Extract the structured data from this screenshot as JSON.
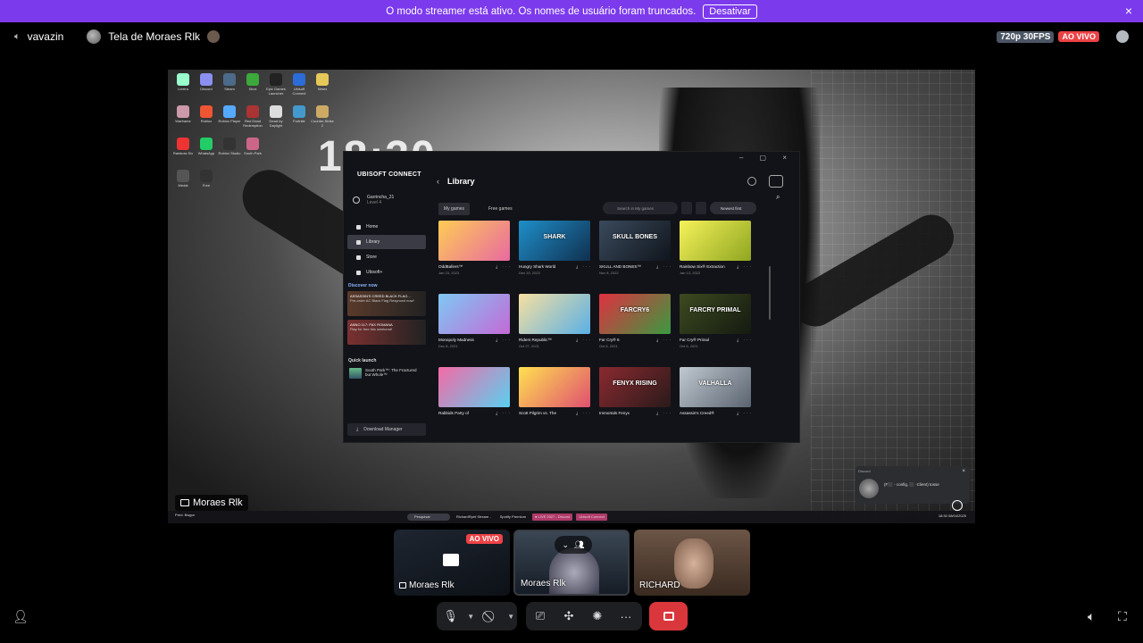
{
  "banner": {
    "message": "O modo streamer está ativo. Os nomes de usuário foram truncados.",
    "button": "Desativar",
    "close_icon": "×"
  },
  "topbar": {
    "channel_name": "vavazin",
    "stream_title": "Tela de Moraes Rlk",
    "quality": "720p 30FPS",
    "live_badge": "AO VIVO"
  },
  "stream": {
    "owner_label": "Moraes Rlk",
    "clock": "18:30",
    "desktop_icons": [
      {
        "label": "Lixeira",
        "color": "#9fc"
      },
      {
        "label": "Discord",
        "color": "#8a8ff0"
      },
      {
        "label": "Steam",
        "color": "#4c6a8a"
      },
      {
        "label": "Xbox",
        "color": "#3ba93b"
      },
      {
        "label": "Epic Games Launcher",
        "color": "#222"
      },
      {
        "label": "Ubisoft Connect",
        "color": "#2b6cd6"
      },
      {
        "label": "filmes",
        "color": "#e6c85a"
      },
      {
        "label": "",
        "color": "transparent"
      },
      {
        "label": "Warframe",
        "color": "#c9a"
      },
      {
        "label": "Roblox",
        "color": "#e53"
      },
      {
        "label": "Roblox Player",
        "color": "#5af"
      },
      {
        "label": "Red Dead Redemption",
        "color": "#a33"
      },
      {
        "label": "Dead by Daylight",
        "color": "#ddd"
      },
      {
        "label": "Fortnite",
        "color": "#49c"
      },
      {
        "label": "Counter-Strike 2",
        "color": "#ca6"
      },
      {
        "label": "",
        "color": "transparent"
      },
      {
        "label": "Rainbow Six",
        "color": "#e33"
      },
      {
        "label": "WhatsApp",
        "color": "#2c6"
      },
      {
        "label": "Roblox Studio",
        "color": "#333"
      },
      {
        "label": "South Park",
        "color": "#c68"
      },
      {
        "label": "",
        "color": "transparent"
      },
      {
        "label": "",
        "color": "transparent"
      },
      {
        "label": "",
        "color": "transparent"
      },
      {
        "label": "",
        "color": "transparent"
      },
      {
        "label": "Medal",
        "color": "#555"
      },
      {
        "label": "Free",
        "color": "#333"
      }
    ]
  },
  "ubisoft": {
    "logo": "UBISOFT CONNECT",
    "window_controls": "– ▢ ×",
    "username": "Garrincha_21",
    "level": "Level 4",
    "nav": [
      {
        "label": "Home",
        "active": false
      },
      {
        "label": "Library",
        "active": true
      },
      {
        "label": "Store",
        "active": false
      },
      {
        "label": "Ubisoft+",
        "active": false
      }
    ],
    "discover_heading": "Discover now",
    "promos": [
      {
        "title": "ASSASSIN'S CREED BLACK FLAG...",
        "subtitle": "Pre-order AC Black Flag Resynced now!",
        "color": "#5a3a2a"
      },
      {
        "title": "ANNO 117: PAX ROMANA",
        "subtitle": "Play for free this weekend!",
        "color": "#7a3030"
      }
    ],
    "quick_launch_heading": "Quick launch",
    "quick_launch_item": "South Park™: The Fractured but Whole™",
    "download_manager": "Download Manager",
    "page_title": "Library",
    "back": "‹",
    "tabs": [
      "My games",
      "Free games"
    ],
    "search_placeholder": "Search in My games",
    "sort": "Newest first",
    "games": [
      {
        "title": "OddBallers™",
        "date": "Jan 23, 2023",
        "cover_text": "",
        "c1": "#ffcc55",
        "c2": "#e86aa0"
      },
      {
        "title": "Hungry Shark World",
        "date": "Dec 20, 2022",
        "cover_text": "SHARK",
        "c1": "#1e8fc9",
        "c2": "#103050"
      },
      {
        "title": "SKULL AND BONES™",
        "date": "Nov 8, 2022",
        "cover_text": "SKULL BONES",
        "c1": "#3a4a5c",
        "c2": "#10151d"
      },
      {
        "title": "Rainbow Six® Extraction",
        "date": "Jan 13, 2022",
        "cover_text": "",
        "c1": "#f6f25a",
        "c2": "#8fa620"
      },
      {
        "title": "Monopoly Madness",
        "date": "Dec 8, 2021",
        "cover_text": "",
        "c1": "#7ec8f4",
        "c2": "#c36ad6"
      },
      {
        "title": "Riders Republic™",
        "date": "Oct 27, 2021",
        "cover_text": "",
        "c1": "#f6e0a0",
        "c2": "#5ab0e6"
      },
      {
        "title": "Far Cry® 6",
        "date": "Oct 6, 2021",
        "cover_text": "FARCRY6",
        "c1": "#e03040",
        "c2": "#3a9a40"
      },
      {
        "title": "Far Cry® Primal",
        "date": "Oct 6, 2021",
        "cover_text": "FARCRY PRIMAL",
        "c1": "#3c4a20",
        "c2": "#151a10"
      },
      {
        "title": "Rabbids Party of",
        "date": "",
        "cover_text": "",
        "c1": "#f46aa6",
        "c2": "#5ad0f0"
      },
      {
        "title": "Scott Pilgrim vs. The",
        "date": "",
        "cover_text": "",
        "c1": "#ffe050",
        "c2": "#e05070"
      },
      {
        "title": "Immortals Fenyx",
        "date": "",
        "cover_text": "FENYX RISING",
        "c1": "#8a2a30",
        "c2": "#2a1a1a"
      },
      {
        "title": "Assassin's Creed®",
        "date": "",
        "cover_text": "VALHALLA",
        "c1": "#c0c8d0",
        "c2": "#5a6470"
      }
    ]
  },
  "notification": {
    "app": "Discord",
    "text": "(F⬛ - config, ⬛ -Client)  tosse",
    "close": "×"
  },
  "taskbar": {
    "weather": "Pred. Bwgor",
    "search": "Pesquisar",
    "apps": [
      {
        "label": "RichardRpet Stream -",
        "red": false
      },
      {
        "label": "Spotify Premium",
        "red": false
      },
      {
        "label": "● LIVE 2027 - Discord",
        "red": true
      },
      {
        "label": "Ubisoft Connect",
        "red": true
      }
    ],
    "datetime": "18:30  08/04/2025"
  },
  "participants": [
    {
      "name": "Moraes Rlk",
      "live": "AO VIVO",
      "screen": true
    },
    {
      "name": "Moraes Rlk",
      "live": "",
      "screen": false
    },
    {
      "name": "RICHARD",
      "live": "",
      "screen": false
    }
  ],
  "controls": {
    "mic_icon": "microphone-icon",
    "camera_icon": "camera-off-icon",
    "share_icon": "screen-share-icon",
    "activities_icon": "activities-icon",
    "soundboard_icon": "soundboard-icon",
    "more": "···"
  }
}
